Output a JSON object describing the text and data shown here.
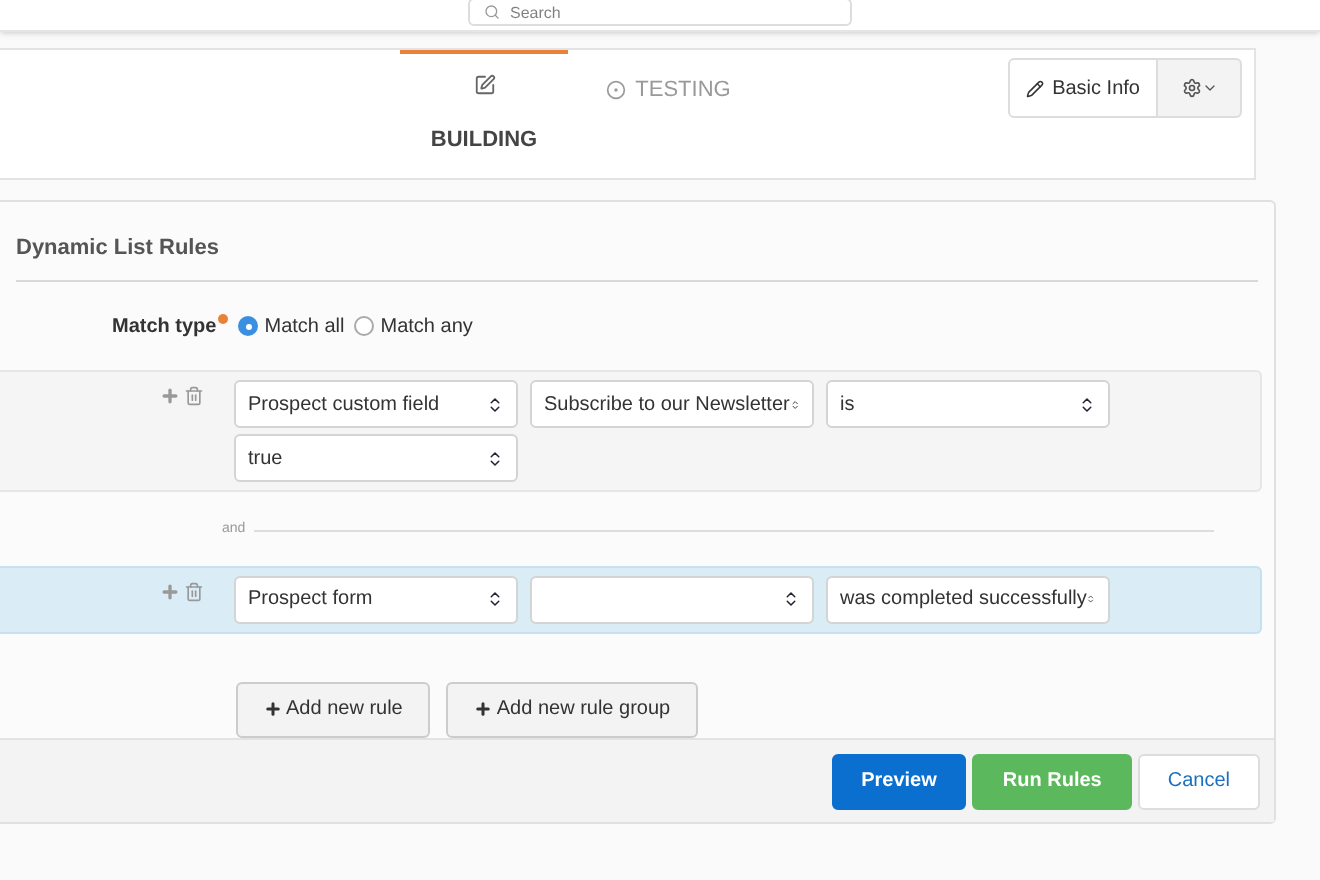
{
  "header": {
    "search": {
      "placeholder": "Search"
    }
  },
  "tabs": [
    {
      "selected": true,
      "title": "BUILDING"
    },
    {
      "label": "TESTING",
      "selected": false
    }
  ],
  "tab_actions": {
    "basic_info": "Basic Info"
  },
  "section": {
    "title": "Dynamic List Rules"
  },
  "match_type": {
    "label": "Match type",
    "required": true,
    "options": [
      {
        "label": "Match all",
        "selected": true
      },
      {
        "label": "Match any",
        "selected": false
      }
    ]
  },
  "rules": [
    {
      "highlighted": false,
      "selects": [
        {
          "kind": "select",
          "value": "Prospect custom field"
        },
        {
          "kind": "select",
          "value": "Subscribe to our Newsletter"
        },
        {
          "kind": "select",
          "value": "is"
        },
        {
          "kind": "select",
          "value": "true"
        }
      ]
    },
    {
      "highlighted": true,
      "selects": [
        {
          "kind": "select",
          "value": "Prospect form"
        },
        {
          "kind": "select"
        },
        {
          "kind": "select",
          "value": "was completed successfully"
        }
      ]
    }
  ],
  "connector": "and",
  "add_buttons": [
    "Add new rule",
    "Add new rule group"
  ],
  "footer_buttons": [
    {
      "label": "Preview",
      "kind": "primary"
    },
    {
      "label": "Run Rules",
      "kind": "success"
    },
    {
      "label": "Cancel",
      "kind": "link"
    }
  ]
}
